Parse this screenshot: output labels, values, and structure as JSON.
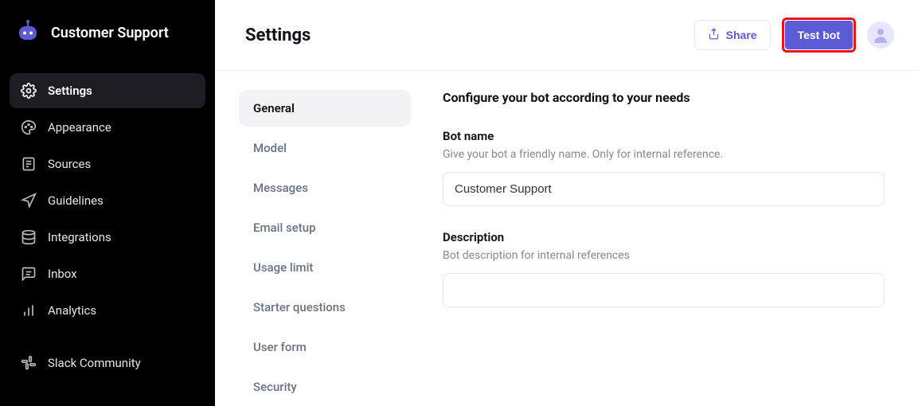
{
  "brand": {
    "name": "Customer Support"
  },
  "sidebar": {
    "items": [
      {
        "label": "Settings"
      },
      {
        "label": "Appearance"
      },
      {
        "label": "Sources"
      },
      {
        "label": "Guidelines"
      },
      {
        "label": "Integrations"
      },
      {
        "label": "Inbox"
      },
      {
        "label": "Analytics"
      }
    ],
    "footer": [
      {
        "label": "Slack Community"
      }
    ]
  },
  "header": {
    "title": "Settings",
    "share_label": "Share",
    "test_label": "Test bot"
  },
  "subnav": {
    "items": [
      {
        "label": "General"
      },
      {
        "label": "Model"
      },
      {
        "label": "Messages"
      },
      {
        "label": "Email setup"
      },
      {
        "label": "Usage limit"
      },
      {
        "label": "Starter questions"
      },
      {
        "label": "User form"
      },
      {
        "label": "Security"
      }
    ]
  },
  "form": {
    "heading": "Configure your bot according to your needs",
    "bot_name": {
      "label": "Bot name",
      "help": "Give your bot a friendly name. Only for internal reference.",
      "value": "Customer Support"
    },
    "description": {
      "label": "Description",
      "help": "Bot description for internal references",
      "value": ""
    }
  }
}
